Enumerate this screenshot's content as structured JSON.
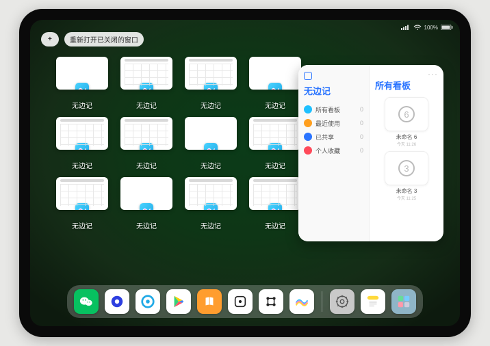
{
  "status": {
    "battery_pct": "100%"
  },
  "topbar": {
    "plus_label": "+",
    "reopen_label": "重新打开已关闭的窗口"
  },
  "switcher": {
    "app_name": "无边记",
    "cards": [
      {
        "variant": "blank"
      },
      {
        "variant": "calendar"
      },
      {
        "variant": "calendar"
      },
      {
        "variant": "blank"
      },
      {
        "variant": "calendar"
      },
      {
        "variant": "calendar"
      },
      {
        "variant": "blank"
      },
      {
        "variant": "calendar"
      },
      {
        "variant": "calendar"
      },
      {
        "variant": "blank"
      },
      {
        "variant": "calendar"
      },
      {
        "variant": "calendar"
      }
    ]
  },
  "preview": {
    "sidebar_title": "无边记",
    "main_title": "所有看板",
    "more_label": "···",
    "items": [
      {
        "label": "所有看板",
        "count": "0",
        "color": "#1fc0ff"
      },
      {
        "label": "最近使用",
        "count": "0",
        "color": "#ff9f1e"
      },
      {
        "label": "已共享",
        "count": "0",
        "color": "#2a74ff"
      },
      {
        "label": "个人收藏",
        "count": "0",
        "color": "#ff4a5a"
      }
    ],
    "boards": [
      {
        "title": "未命名 6",
        "subtitle": "今天 11:26",
        "glyph": "6"
      },
      {
        "title": "未命名 3",
        "subtitle": "今天 11:25",
        "glyph": "3"
      }
    ]
  },
  "dock": {
    "icons": [
      {
        "name": "wechat",
        "bg": "#07c160"
      },
      {
        "name": "quark",
        "bg": "#ffffff"
      },
      {
        "name": "qqbrowser",
        "bg": "#ffffff"
      },
      {
        "name": "play",
        "bg": "#ffffff"
      },
      {
        "name": "books",
        "bg": "#ff9d2e"
      },
      {
        "name": "dice",
        "bg": "#ffffff"
      },
      {
        "name": "grid",
        "bg": "#ffffff"
      },
      {
        "name": "freeform",
        "bg": "#ffffff"
      },
      {
        "name": "settings",
        "bg": "#c9c9c9"
      },
      {
        "name": "notes",
        "bg": "#ffffff"
      },
      {
        "name": "app-library",
        "bg": "#8fb5c7"
      }
    ],
    "separator_after": 7
  }
}
